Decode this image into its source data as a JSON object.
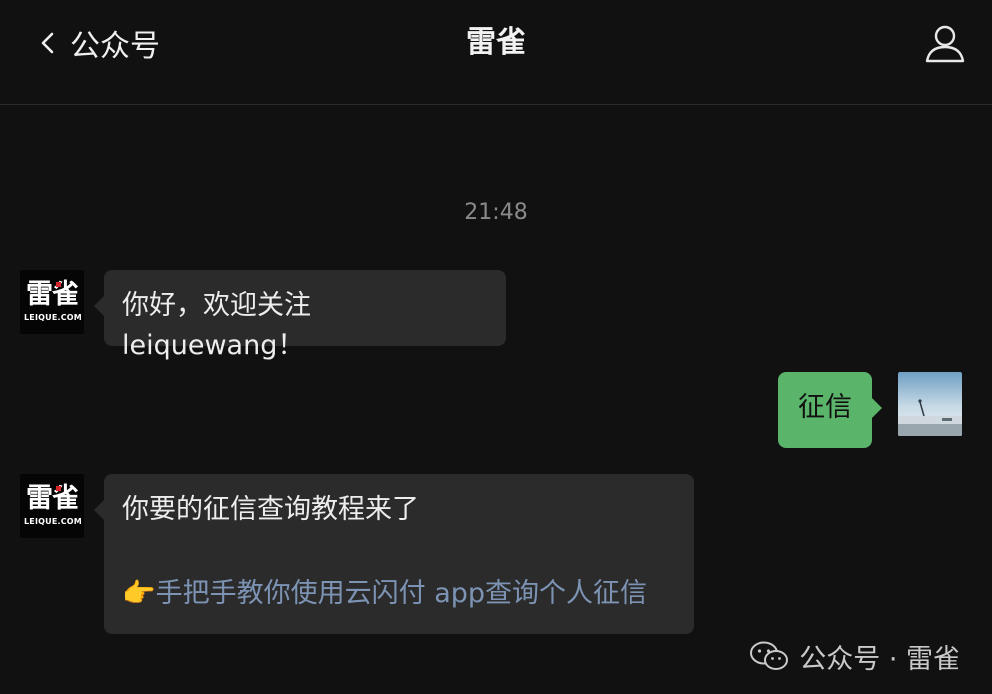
{
  "header": {
    "back_label": "公众号",
    "title": "雷雀"
  },
  "chat": {
    "timestamp": "21:48",
    "account_avatar": {
      "logo_top": "雷雀",
      "logo_bottom": "LEIQUE.COM"
    },
    "messages": [
      {
        "from": "account",
        "text": "你好，欢迎关注 leiquewang！"
      },
      {
        "from": "me",
        "text": "征信"
      },
      {
        "from": "account",
        "text": "你要的征信查询教程来了",
        "link_emoji": "👉",
        "link_text": "手把手教你使用云闪付 app查询个人征信"
      }
    ]
  },
  "watermark": {
    "text": "公众号 · 雷雀"
  },
  "colors": {
    "background": "#111111",
    "incoming_bubble": "#2b2b2b",
    "outgoing_bubble": "#5ab46a",
    "link": "#7c93b4"
  }
}
